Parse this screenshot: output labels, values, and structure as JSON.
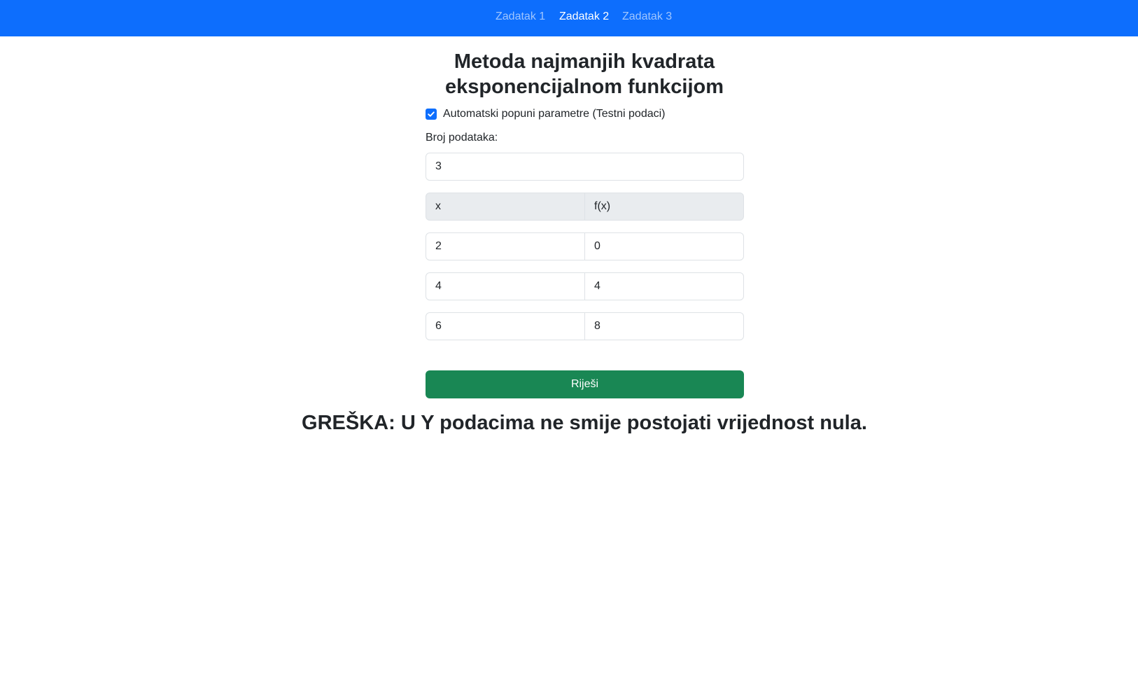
{
  "nav": {
    "items": [
      {
        "label": "Zadatak 1",
        "active": false
      },
      {
        "label": "Zadatak 2",
        "active": true
      },
      {
        "label": "Zadatak 3",
        "active": false
      }
    ]
  },
  "page": {
    "title_line1": "Metoda najmanjih kvadrata",
    "title_line2": "eksponencijalnom funkcijom"
  },
  "autofill": {
    "label": "Automatski popuni parametre (Testni podaci)",
    "checked": true
  },
  "count": {
    "label": "Broj podataka:",
    "value": "3"
  },
  "table": {
    "headers": [
      "x",
      "f(x)"
    ],
    "rows": [
      {
        "x": "2",
        "fx": "0"
      },
      {
        "x": "4",
        "fx": "4"
      },
      {
        "x": "6",
        "fx": "8"
      }
    ]
  },
  "solve_button": {
    "label": "Riješi"
  },
  "error": {
    "message": "GREŠKA: U Y podacima ne smije postojati vrijednost nula."
  },
  "colors": {
    "navbar": "#0d6efd",
    "button": "#198754",
    "checkbox": "#0d6efd",
    "header_bg": "#e9ecef"
  }
}
